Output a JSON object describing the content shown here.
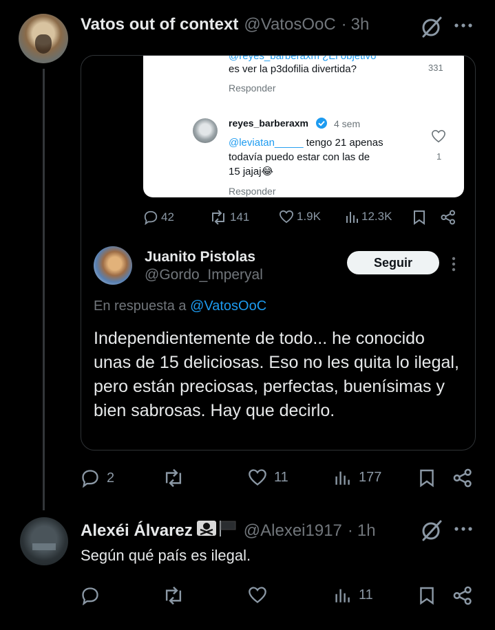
{
  "main_tweet": {
    "display_name": "Vatos out of context",
    "handle": "@VatosOoC",
    "separator": "·",
    "time": "3h",
    "actions": {
      "reply": "2",
      "repost": "",
      "like": "11",
      "views": "177"
    }
  },
  "quote_screenshot": {
    "cut_text": "@reyes_barberaxm ¿El objetivo",
    "line1": "es ver la p3dofilia divertida?",
    "count_top": "331",
    "reply_label_1": "Responder",
    "user": "reyes_barberaxm",
    "time": "4 sem",
    "mention": "@leviatan_____",
    "line_a": " tengo 21 apenas",
    "line_b": "todavía puedo estar con las de",
    "line_c": "15 jajaj😂",
    "like_count": "1",
    "reply_label_2": "Responder"
  },
  "quote_actions": {
    "reply": "42",
    "repost": "141",
    "like": "1.9K",
    "views": "12.3K"
  },
  "quoted_tweet": {
    "display_name": "Juanito Pistolas",
    "handle": "@Gordo_Imperyal",
    "follow_label": "Seguir",
    "reply_prefix": "En respuesta a ",
    "reply_mention": "@VatosOoC",
    "body": "Independientemente de todo... he conocido unas de 15 deliciosas. Eso no les quita lo ilegal, pero están preciosas, perfectas, buenísimas y bien sabrosas. Hay que decirlo."
  },
  "reply_tweet": {
    "display_name": "Alexéi Álvarez",
    "handle": "@Alexei1917",
    "separator": "·",
    "time": "1h",
    "body": "Según qué país es ilegal.",
    "actions": {
      "reply": "",
      "repost": "",
      "like": "",
      "views": "11"
    }
  },
  "icons": {
    "reply": "reply-icon",
    "repost": "repost-icon",
    "like": "heart-icon",
    "views": "views-icon",
    "bookmark": "bookmark-icon",
    "share": "share-icon",
    "grok": "grok-icon",
    "more": "more-icon",
    "flag": "black-flag-icon",
    "skull": "skull-crossbones-icon"
  },
  "colors": {
    "background": "#000000",
    "text": "#e7e9ea",
    "muted": "#71767b",
    "accent": "#1d9bf0",
    "border": "#2f3336"
  }
}
